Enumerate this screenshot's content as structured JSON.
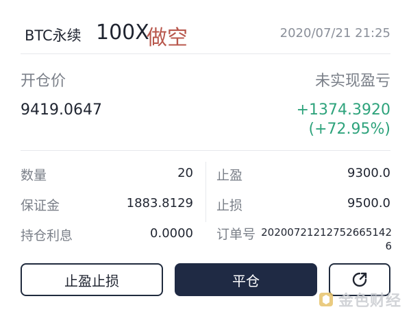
{
  "header": {
    "symbol": "BTC永续",
    "leverage": "100X",
    "side": "做空",
    "timestamp": "2020/07/21 21:25"
  },
  "position": {
    "entry_price_label": "开仓价",
    "entry_price": "9419.0647",
    "unrealized_pnl_label": "未实现盈亏",
    "unrealized_pnl": "+1374.3920",
    "unrealized_pnl_pct": "(+72.95%)"
  },
  "details": {
    "quantity_label": "数量",
    "quantity": "20",
    "margin_label": "保证金",
    "margin": "1883.8129",
    "funding_label": "持仓利息",
    "funding": "0.0000",
    "take_profit_label": "止盈",
    "take_profit": "9300.0",
    "stop_loss_label": "止损",
    "stop_loss": "9500.0",
    "order_no_label": "订单号",
    "order_no": "20200721212752665142 6"
  },
  "actions": {
    "tp_sl_label": "止盈止损",
    "close_label": "平仓",
    "share_icon": "share-icon"
  },
  "watermark": {
    "text": "金色财经"
  },
  "colors": {
    "short": "#b8574c",
    "profit": "#2ea37c",
    "primary": "#1f2a44"
  }
}
